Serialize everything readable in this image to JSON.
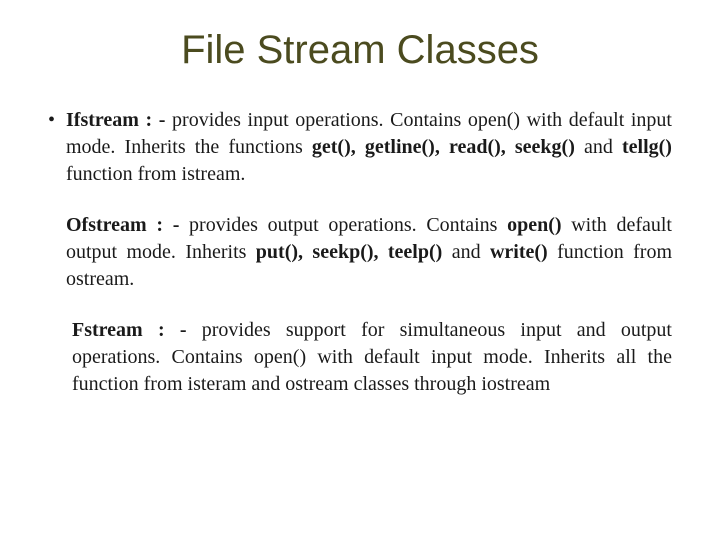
{
  "title": "File Stream Classes",
  "items": [
    {
      "bulleted": true,
      "name": "Ifstream",
      "sep": " : - ",
      "body_pre": "provides input operations. Contains open() with default input mode. Inherits the functions ",
      "funcs": "get(), getline(), read(), seekg()",
      "body_mid": " and ",
      "funcs2": "tellg()",
      "body_post": " function from istream."
    },
    {
      "bulleted": false,
      "name": "Ofstream",
      "sep": " : - ",
      "body_pre": "provides output operations. Contains ",
      "funcs": "open()",
      "body_mid": " with default output mode. Inherits ",
      "funcs2": "put(), seekp(), teelp()",
      "body_mid2": " and ",
      "funcs3": "write()",
      "body_post": " function from ostream."
    },
    {
      "bulleted": false,
      "name": "Fstream",
      "sep": " : - ",
      "body_pre": "provides support for simultaneous input and output operations. Contains open() with default input mode. Inherits all the function from isteram and ostream classes through iostream",
      "funcs": "",
      "body_mid": "",
      "funcs2": "",
      "body_post": ""
    }
  ]
}
